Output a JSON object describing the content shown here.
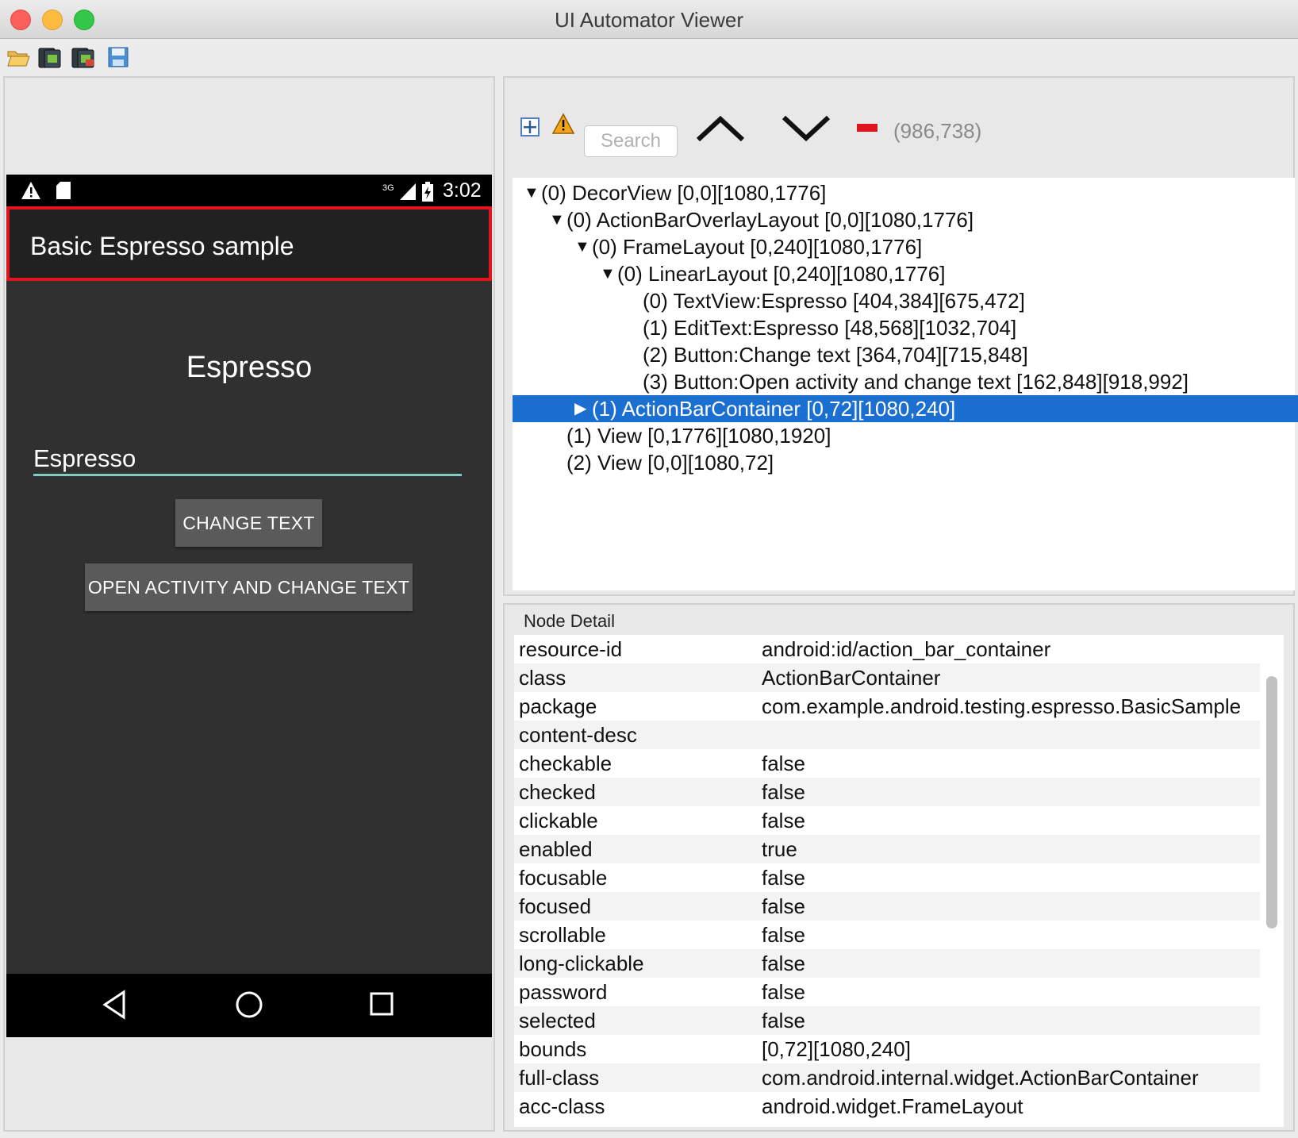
{
  "window": {
    "title": "UI Automator Viewer"
  },
  "toolbar": {
    "icons": [
      "open-folder-icon",
      "device-screenshot-icon",
      "device-screenshot-compressed-icon",
      "save-icon"
    ]
  },
  "device": {
    "status_time": "3:02",
    "network": "3G",
    "action_bar_title": "Basic Espresso sample",
    "heading": "Espresso",
    "edit_text": "Espresso",
    "buttons": {
      "change_text": "CHANGE TEXT",
      "open_activity": "OPEN ACTIVITY AND CHANGE TEXT"
    },
    "nav": [
      "back-icon",
      "home-icon",
      "recents-icon"
    ]
  },
  "hierarchy": {
    "search_placeholder": "Search",
    "coordinates": "(986,738)",
    "nodes": [
      {
        "label": "(0) DecorView [0,0][1080,1776]",
        "arrow": "▼",
        "selected": false
      },
      {
        "label": "(0) ActionBarOverlayLayout [0,0][1080,1776]",
        "arrow": "▼",
        "selected": false
      },
      {
        "label": "(0) FrameLayout [0,240][1080,1776]",
        "arrow": "▼",
        "selected": false
      },
      {
        "label": "(0) LinearLayout [0,240][1080,1776]",
        "arrow": "▼",
        "selected": false
      },
      {
        "label": "(0) TextView:Espresso [404,384][675,472]",
        "arrow": "",
        "selected": false
      },
      {
        "label": "(1) EditText:Espresso [48,568][1032,704]",
        "arrow": "",
        "selected": false
      },
      {
        "label": "(2) Button:Change text [364,704][715,848]",
        "arrow": "",
        "selected": false
      },
      {
        "label": "(3) Button:Open activity and change text [162,848][918,992]",
        "arrow": "",
        "selected": false
      },
      {
        "label": "(1) ActionBarContainer [0,72][1080,240]",
        "arrow": "▶",
        "selected": true
      },
      {
        "label": "(1) View [0,1776][1080,1920]",
        "arrow": "",
        "selected": false
      },
      {
        "label": "(2) View [0,0][1080,72]",
        "arrow": "",
        "selected": false
      }
    ]
  },
  "node_detail": {
    "title": "Node Detail",
    "rows": [
      {
        "key": "resource-id",
        "value": "android:id/action_bar_container"
      },
      {
        "key": "class",
        "value": "ActionBarContainer"
      },
      {
        "key": "package",
        "value": "com.example.android.testing.espresso.BasicSample"
      },
      {
        "key": "content-desc",
        "value": ""
      },
      {
        "key": "checkable",
        "value": "false"
      },
      {
        "key": "checked",
        "value": "false"
      },
      {
        "key": "clickable",
        "value": "false"
      },
      {
        "key": "enabled",
        "value": "true"
      },
      {
        "key": "focusable",
        "value": "false"
      },
      {
        "key": "focused",
        "value": "false"
      },
      {
        "key": "scrollable",
        "value": "false"
      },
      {
        "key": "long-clickable",
        "value": "false"
      },
      {
        "key": "password",
        "value": "false"
      },
      {
        "key": "selected",
        "value": "false"
      },
      {
        "key": "bounds",
        "value": "[0,72][1080,240]"
      },
      {
        "key": "full-class",
        "value": "com.android.internal.widget.ActionBarContainer"
      },
      {
        "key": "acc-class",
        "value": "android.widget.FrameLayout"
      }
    ]
  }
}
